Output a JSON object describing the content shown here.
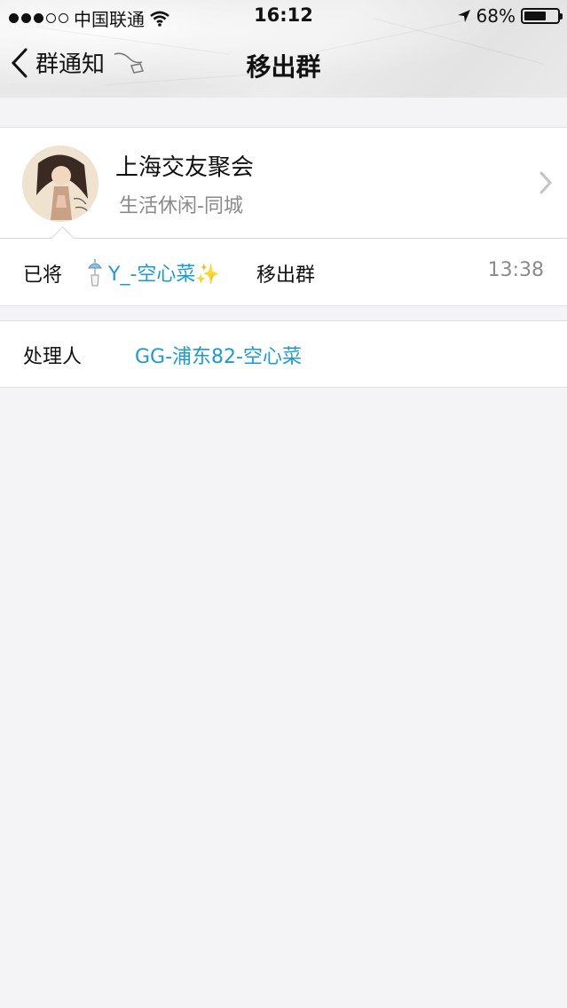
{
  "status_bar": {
    "carrier": "中国联通",
    "time": "16:12",
    "battery_percent": "68%",
    "battery_level": 0.68,
    "signal_bars_filled": 3,
    "signal_bars_total": 5
  },
  "nav": {
    "back_label": "群通知",
    "title": "移出群"
  },
  "group": {
    "name": "上海交友聚会",
    "category": "生活休闲-同城"
  },
  "notice": {
    "prefix": "已将",
    "user": "Y_-空心菜✨",
    "suffix": "移出群",
    "time": "13:38"
  },
  "handler": {
    "label": "处理人",
    "value": "GG-浦东82-空心菜"
  },
  "colors": {
    "link": "#1c9ad6",
    "background": "#f4f4f6"
  }
}
